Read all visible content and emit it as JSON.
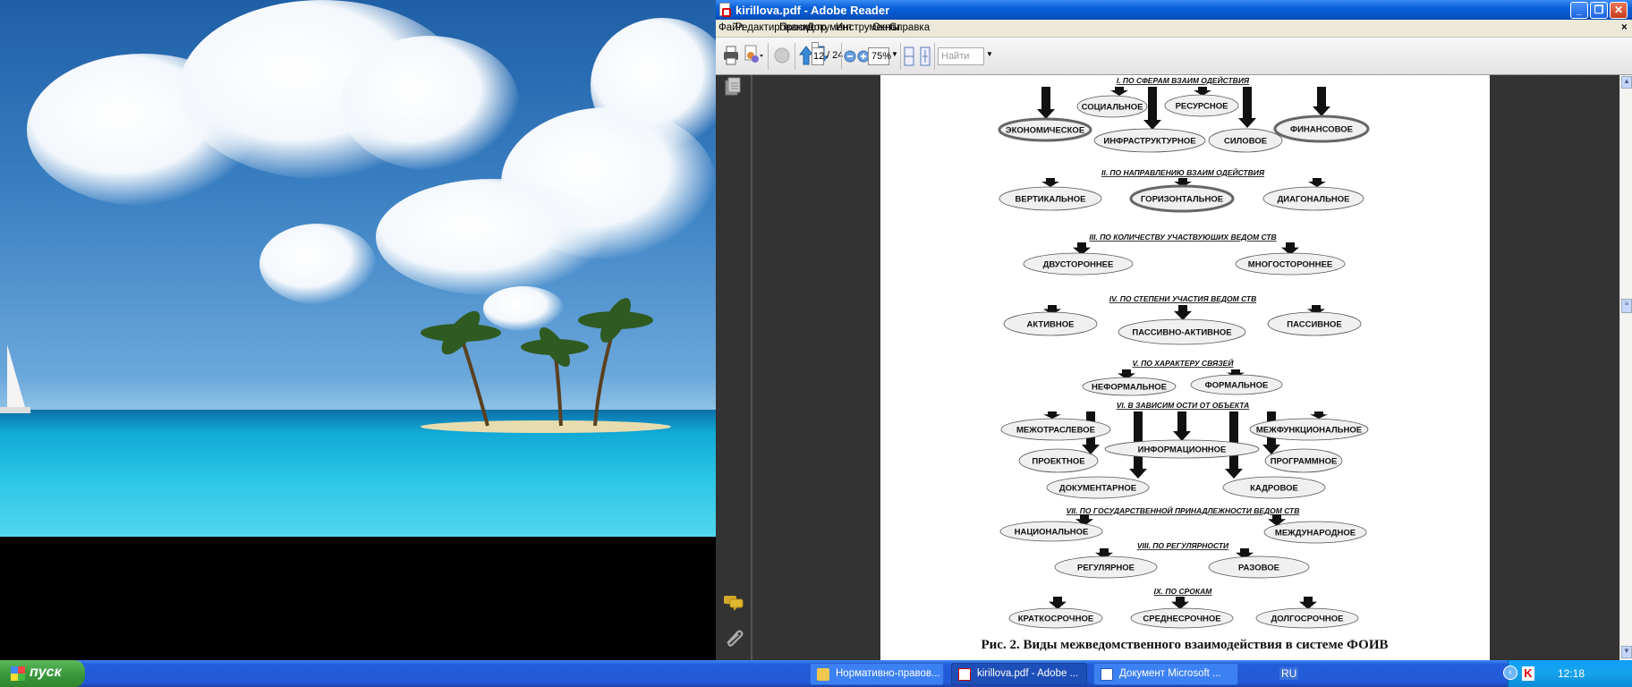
{
  "window": {
    "title": "kirillova.pdf - Adobe Reader",
    "controls": [
      "minimize",
      "restore",
      "close"
    ]
  },
  "menu": [
    "Файл",
    "Редактирование",
    "Просмотр",
    "Документ",
    "Инструменты",
    "Окно",
    "Справка"
  ],
  "toolbar": {
    "page_current": "12",
    "page_total": "/ 24",
    "zoom": "75%",
    "find_placeholder": "Найти"
  },
  "diagram": {
    "sections": [
      {
        "title": "I. ПО СФЕРАМ  ВЗАИМ ОДЕЙСТВИЯ",
        "items": [
          "ЭКОНОМИЧЕСКОЕ",
          "СОЦИАЛЬНОЕ",
          "РЕСУРСНОЕ",
          "ИНФРАСТРУКТУРНОЕ",
          "СИЛОВОЕ",
          "ФИНАНСОВОЕ"
        ]
      },
      {
        "title": "II. ПО НАПРАВЛЕНИЮ ВЗАИМ ОДЕЙСТВИЯ",
        "items": [
          "ВЕРТИКАЛЬНОЕ",
          "ГОРИЗОНТАЛЬНОЕ",
          "ДИАГОНАЛЬНОЕ"
        ]
      },
      {
        "title": "III. ПО КОЛИЧЕСТВУ УЧАСТВУЮШИХ ВЕДОМ СТВ",
        "items": [
          "ДВУСТОРОННЕЕ",
          "МНОГОСТОРОННЕЕ"
        ]
      },
      {
        "title": "IV. ПО СТЕПЕНИ УЧАСТИЯ ВЕДОМ СТВ",
        "items": [
          "АКТИВНОЕ",
          "ПАССИВНО-АКТИВНОЕ",
          "ПАССИВНОЕ"
        ]
      },
      {
        "title": "V. ПО ХАРАКТЕРУ СВЯЗЕЙ",
        "items": [
          "НЕФОРМАЛЬНОЕ",
          "ФОРМАЛЬНОЕ"
        ]
      },
      {
        "title": "VI. В ЗАВИСИМ ОСТИ ОТ ОБЪЕКТА",
        "items": [
          "МЕЖОТРАСЛЕВОЕ",
          "МЕЖФУНКЦИОНАЛЬНОЕ",
          "ИНФОРМАЦИОННОЕ",
          "ПРОЕКТНОЕ",
          "ПРОГРАММНОЕ",
          "ДОКУМЕНТАРНОЕ",
          "КАДРОВОЕ"
        ]
      },
      {
        "title": "VII. ПО ГОСУДАРСТВЕННОЙ ПРИНАДЛЕЖНОСТИ ВЕДОМ СТВ",
        "items": [
          "НАЦИОНАЛЬНОЕ",
          "МЕЖДУНАРОДНОЕ"
        ]
      },
      {
        "title": "VIII. ПО РЕГУЛЯРНОСТИ",
        "items": [
          "РЕГУЛЯРНОЕ",
          "РАЗОВОЕ"
        ]
      },
      {
        "title": "IX. ПО СРОКАМ",
        "items": [
          "КРАТКОСРОЧНОЕ",
          "СРЕДНЕСРОЧНОЕ",
          "ДОЛГОСРОЧНОЕ"
        ]
      }
    ],
    "caption": "Рис. 2. Виды межведомственного взаимодействия в системе ФОИВ"
  },
  "taskbar": {
    "start": "пуск",
    "tasks": [
      "Нормативно-правов...",
      "kirillova.pdf - Adobe ...",
      "Документ Microsoft ..."
    ],
    "lang": "RU",
    "clock": "12:18"
  }
}
